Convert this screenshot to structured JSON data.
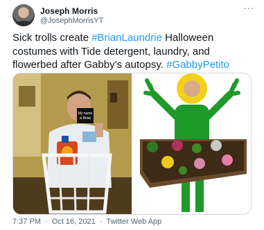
{
  "author": {
    "name": "Joseph Morris",
    "handle": "@JosephMorrisYT"
  },
  "more_icon": "ellipsis-icon",
  "tweet": {
    "text_1": "Sick trolls create ",
    "hashtag_1": "#BrianLaundrie",
    "text_2": " Halloween costumes with Tide detergent, laundry, and flowerbed after Gabby’s autopsy. ",
    "hashtag_2": "#GabbyPetito"
  },
  "media": {
    "left_sign_text": "My name is Brian"
  },
  "footer": {
    "time": "7:37 PM",
    "separator_1": "·",
    "date": "Oct 16, 2021",
    "separator_2": "·",
    "source": "Twitter Web App"
  },
  "colors": {
    "link": "#1d9bf0",
    "secondary_text": "#536471"
  }
}
